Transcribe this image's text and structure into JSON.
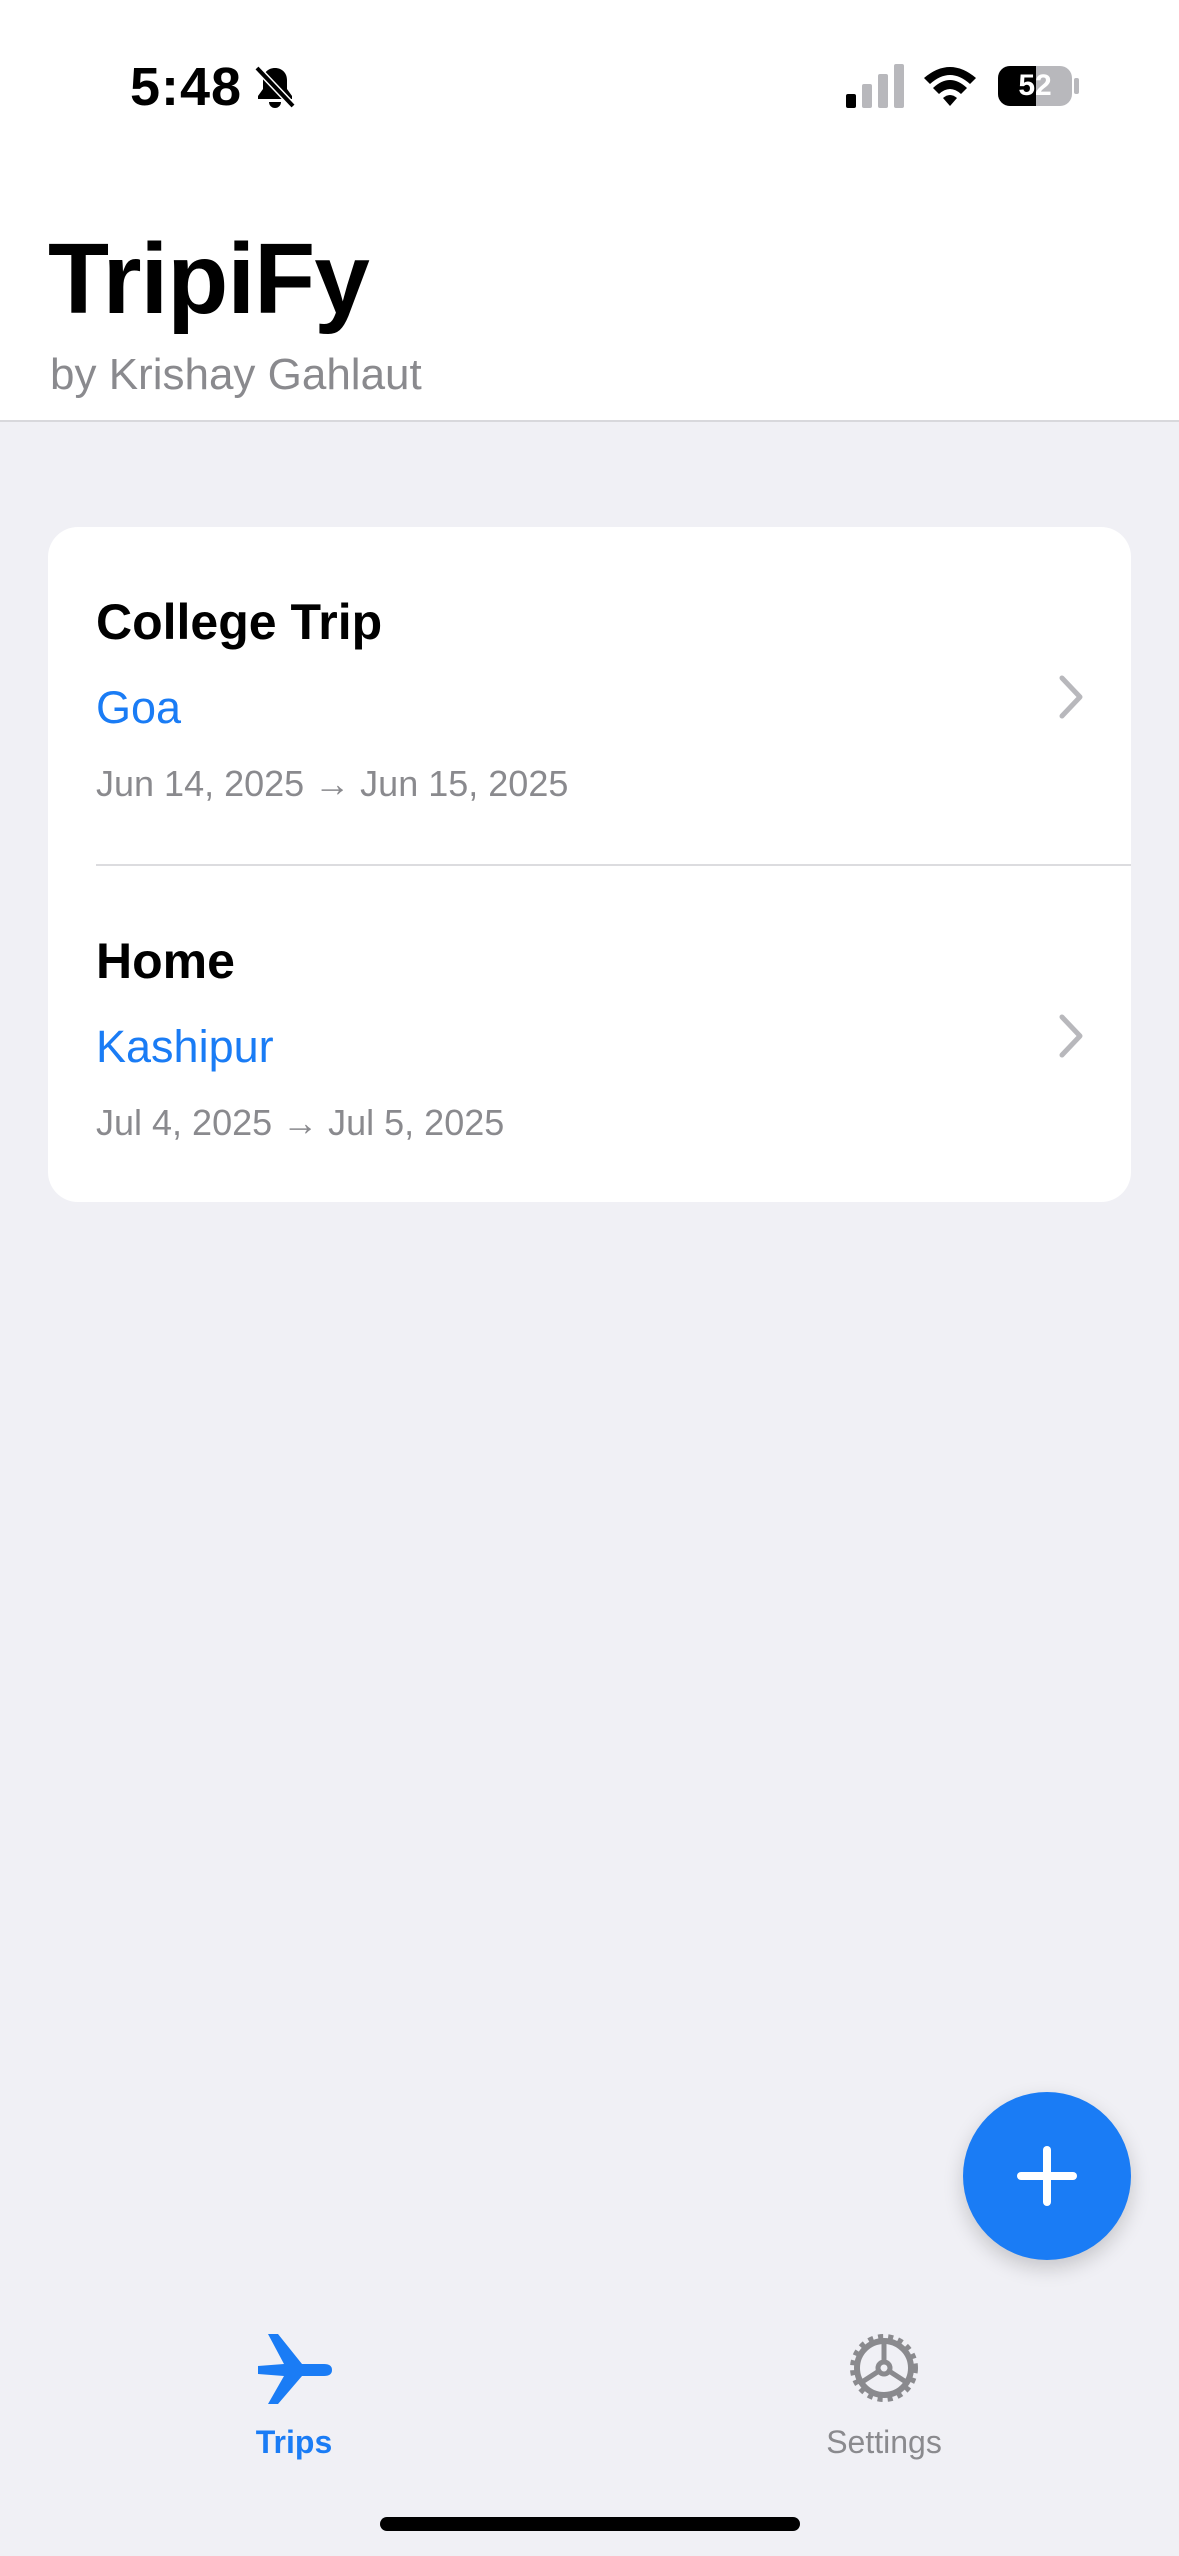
{
  "status_bar": {
    "time": "5:48",
    "battery": "52"
  },
  "header": {
    "title": "TripiFy",
    "subtitle": "by Krishay Gahlaut"
  },
  "trips": [
    {
      "name": "College Trip",
      "destination": "Goa",
      "dates": "Jun 14, 2025 → Jun 15, 2025"
    },
    {
      "name": "Home",
      "destination": "Kashipur",
      "dates": "Jul 4, 2025 → Jul 5, 2025"
    }
  ],
  "tab_bar": {
    "trips_label": "Trips",
    "settings_label": "Settings",
    "selected": "Trips"
  },
  "colors": {
    "accent": "#1a7cf5",
    "background": "#f0f0f5",
    "secondary_text": "#8a8a8e"
  },
  "icons": {
    "add": "plus-icon",
    "trips_tab": "airplane-icon",
    "settings_tab": "gear-icon",
    "row_disclosure": "chevron-right-icon"
  }
}
